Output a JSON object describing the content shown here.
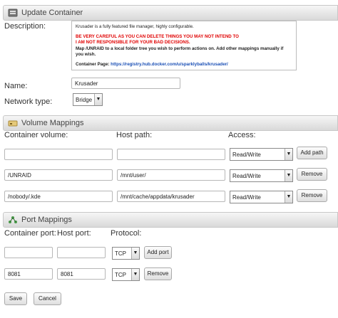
{
  "update": {
    "title": "Update Container",
    "description_label": "Description:",
    "description": {
      "line1": "Krusader is a fully featured file manager, highly configurable.",
      "warn1": "BE VERY CAREFUL AS YOU CAN DELETE THINGS YOU MAY NOT INTEND TO",
      "warn2": "I AM NOT RESPONSIBLE FOR YOUR BAD DECISIONS.",
      "line4": "Map /UNRAID to a local folder tree you wish to perform actions on. Add other mappings manually if you wish.",
      "page_label": "Container Page: ",
      "page_link": "https://registry.hub.docker.com/u/sparklyballs/krusader/"
    },
    "name_label": "Name:",
    "name_value": "Krusader",
    "network_label": "Network type:",
    "network_value": "Bridge"
  },
  "volumes": {
    "title": "Volume Mappings",
    "col_container": "Container volume:",
    "col_host": "Host path:",
    "col_access": "Access:",
    "rows": [
      {
        "container": "",
        "host": "",
        "access": "Read/Write",
        "button": "Add path"
      },
      {
        "container": "/UNRAID",
        "host": "/mnt/user/",
        "access": "Read/Write",
        "button": "Remove"
      },
      {
        "container": "/nobody/.kde",
        "host": "/mnt/cache/appdata/krusader",
        "access": "Read/Write",
        "button": "Remove"
      }
    ]
  },
  "ports": {
    "title": "Port Mappings",
    "col_container": "Container port:",
    "col_host": "Host port:",
    "col_protocol": "Protocol:",
    "rows": [
      {
        "container": "",
        "host": "",
        "protocol": "TCP",
        "button": "Add port"
      },
      {
        "container": "8081",
        "host": "8081",
        "protocol": "TCP",
        "button": "Remove"
      }
    ]
  },
  "actions": {
    "save": "Save",
    "cancel": "Cancel"
  }
}
